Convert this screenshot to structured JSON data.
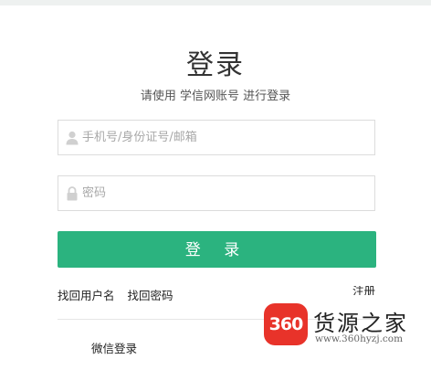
{
  "page": {
    "title": "登录",
    "subtitle": "请使用 学信网账号 进行登录"
  },
  "form": {
    "username": {
      "icon": "user-icon",
      "placeholder": "手机号/身份证号/邮箱",
      "value": ""
    },
    "password": {
      "icon": "lock-icon",
      "placeholder": "密码",
      "value": ""
    },
    "submit_label": "登 录"
  },
  "links": {
    "find_username": "找回用户名",
    "find_password": "找回密码",
    "register": "注册",
    "wechat_login": "微信登录"
  },
  "watermark": {
    "badge": "360",
    "name": "货源之家",
    "url": "www.360hyzj.com"
  },
  "colors": {
    "accent": "#2bb37f",
    "watermark_red": "#e8332a"
  }
}
